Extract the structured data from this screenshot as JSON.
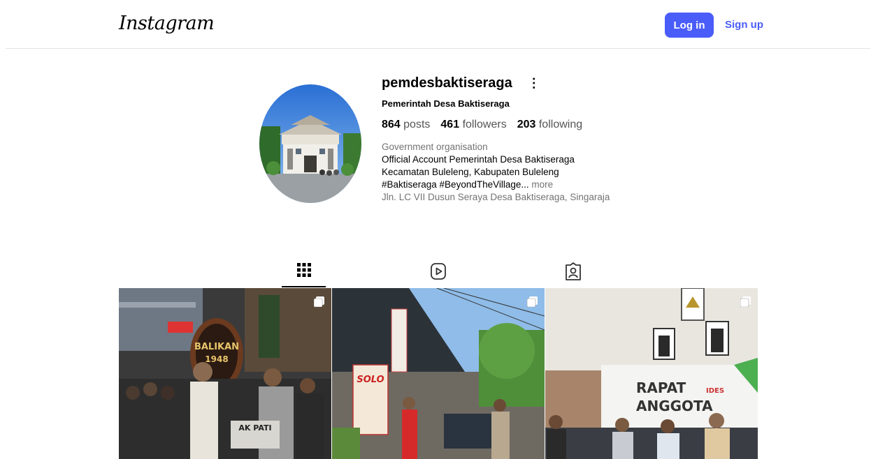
{
  "nav": {
    "logo": "Instagram",
    "login_label": "Log in",
    "signup_label": "Sign up",
    "accent": "#4a5df9"
  },
  "profile": {
    "username": "pemdesbaktiseraga",
    "full_name": "Pemerintah Desa Baktiseraga",
    "stats": {
      "posts_count": "864",
      "posts_label": "posts",
      "followers_count": "461",
      "followers_label": "followers",
      "following_count": "203",
      "following_label": "following"
    },
    "category": "Government organisation",
    "bio_lines": [
      "Official Account Pemerintah Desa Baktiseraga",
      "Kecamatan Buleleng, Kabupaten Buleleng",
      "#Baktiseraga #BeyondTheVillage..."
    ],
    "more_label": " more",
    "address": "Jln. LC VII Dusun Seraya Desa Baktiseraga, Singaraja"
  },
  "tabs": [
    {
      "icon": "grid-icon",
      "active": true
    },
    {
      "icon": "reels-icon",
      "active": false
    },
    {
      "icon": "tagged-icon",
      "active": false
    }
  ],
  "posts": [
    {
      "sign_text": [
        "BALIKAN",
        "1948"
      ],
      "banner_text": "AK PATI",
      "multi": true
    },
    {
      "sign_text": [
        "SOLO"
      ],
      "multi": true
    },
    {
      "banner_text": [
        "RAPAT",
        "ANGGOTA"
      ],
      "logo_text": "IDES",
      "multi": true
    }
  ]
}
